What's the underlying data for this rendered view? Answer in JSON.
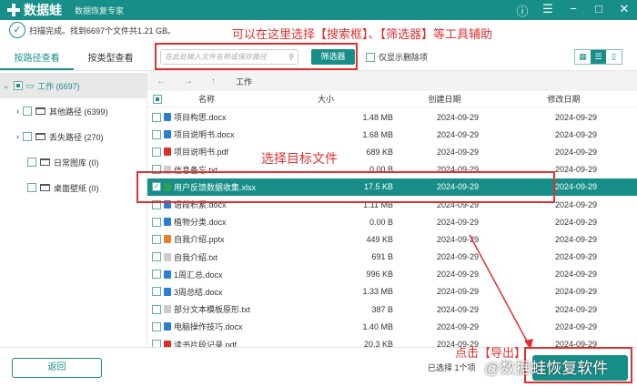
{
  "app": {
    "name": "数据蛙",
    "subtitle": "数据恢复专家",
    "brand_color": "#178e88"
  },
  "status": "扫描完成。找到6697个文件共1.21 GB。",
  "tabs": [
    {
      "label": "按路径查看",
      "active": true
    },
    {
      "label": "按类型查看",
      "active": false
    }
  ],
  "tree": [
    {
      "label": "工作 (6697)",
      "level": 0,
      "expanded": true
    },
    {
      "label": "其他路径 (6399)",
      "level": 1,
      "expandable": true
    },
    {
      "label": "丢失路径 (270)",
      "level": 1,
      "expandable": true
    },
    {
      "label": "日常图库 (0)",
      "level": 1
    },
    {
      "label": "桌面壁纸 (0)",
      "level": 1
    }
  ],
  "toolbar": {
    "search_placeholder": "在此处输入文件名称或保存路径",
    "filter_label": "筛选器",
    "deleted_only_label": "仅显示删除项"
  },
  "nav": {
    "back": "←",
    "forward": "→",
    "up": "↑",
    "path": "工作"
  },
  "columns": {
    "name": "名称",
    "size": "大小",
    "created": "创建日期",
    "modified": "修改日期"
  },
  "files": [
    {
      "name": "项目构思.docx",
      "type": "docx",
      "size": "1.48 MB",
      "created": "2024-09-29",
      "modified": "2024-09-29"
    },
    {
      "name": "项目说明书.docx",
      "type": "docx",
      "size": "1.68 MB",
      "created": "2024-09-29",
      "modified": "2024-09-29"
    },
    {
      "name": "项目说明书.pdf",
      "type": "pdf",
      "size": "689 KB",
      "created": "2024-09-29",
      "modified": "2024-09-29"
    },
    {
      "name": "信息备忘.txt",
      "type": "txt",
      "size": "0.00  B",
      "created": "2024-09-29",
      "modified": "2024-09-29"
    },
    {
      "name": "用户反馈数据收集.xlsx",
      "type": "xlsx",
      "size": "17.5 KB",
      "created": "2024-09-29",
      "modified": "2024-09-29",
      "selected": true
    },
    {
      "name": "语段积累.docx",
      "type": "docx",
      "size": "1.11 MB",
      "created": "2024-09-29",
      "modified": "2024-09-29"
    },
    {
      "name": "植物分类.docx",
      "type": "docx",
      "size": "0.00  B",
      "created": "2024-09-29",
      "modified": "2024-09-29"
    },
    {
      "name": "自我介绍.pptx",
      "type": "pptx",
      "size": "449 KB",
      "created": "2024-09-29",
      "modified": "2024-09-29"
    },
    {
      "name": "自我介绍.txt",
      "type": "txt",
      "size": "691  B",
      "created": "2024-09-29",
      "modified": "2024-09-29"
    },
    {
      "name": "1周汇总.docx",
      "type": "docx",
      "size": "996 KB",
      "created": "2024-09-29",
      "modified": "2024-09-29"
    },
    {
      "name": "3周总结.docx",
      "type": "docx",
      "size": "1.33 MB",
      "created": "2024-09-29",
      "modified": "2024-09-29"
    },
    {
      "name": "部分文本模板原形.txt",
      "type": "txt",
      "size": "387  B",
      "created": "2024-09-29",
      "modified": "2024-09-29"
    },
    {
      "name": "电脑操作技巧.docx",
      "type": "docx",
      "size": "1.40 MB",
      "created": "2024-09-29",
      "modified": "2024-09-29"
    },
    {
      "name": "读书片段记录.pdf",
      "type": "pdf",
      "size": "20.3 KB",
      "created": "2024-09-29",
      "modified": "2024-09-29"
    }
  ],
  "bottom": {
    "back_label": "返回",
    "selection_info": "已选择 1个项"
  },
  "annotations": {
    "top": "可以在这里选择【搜索框】、【筛选器】等工具辅助",
    "select": "选择目标文件",
    "export": "点击【导出】",
    "watermark": "@数据蛙恢复软件"
  },
  "icon_colors": {
    "docx": "#2b7cd3",
    "pdf": "#d9302c",
    "txt": "#cccccc",
    "xlsx": "#2e9e5b",
    "pptx": "#e8812b"
  }
}
